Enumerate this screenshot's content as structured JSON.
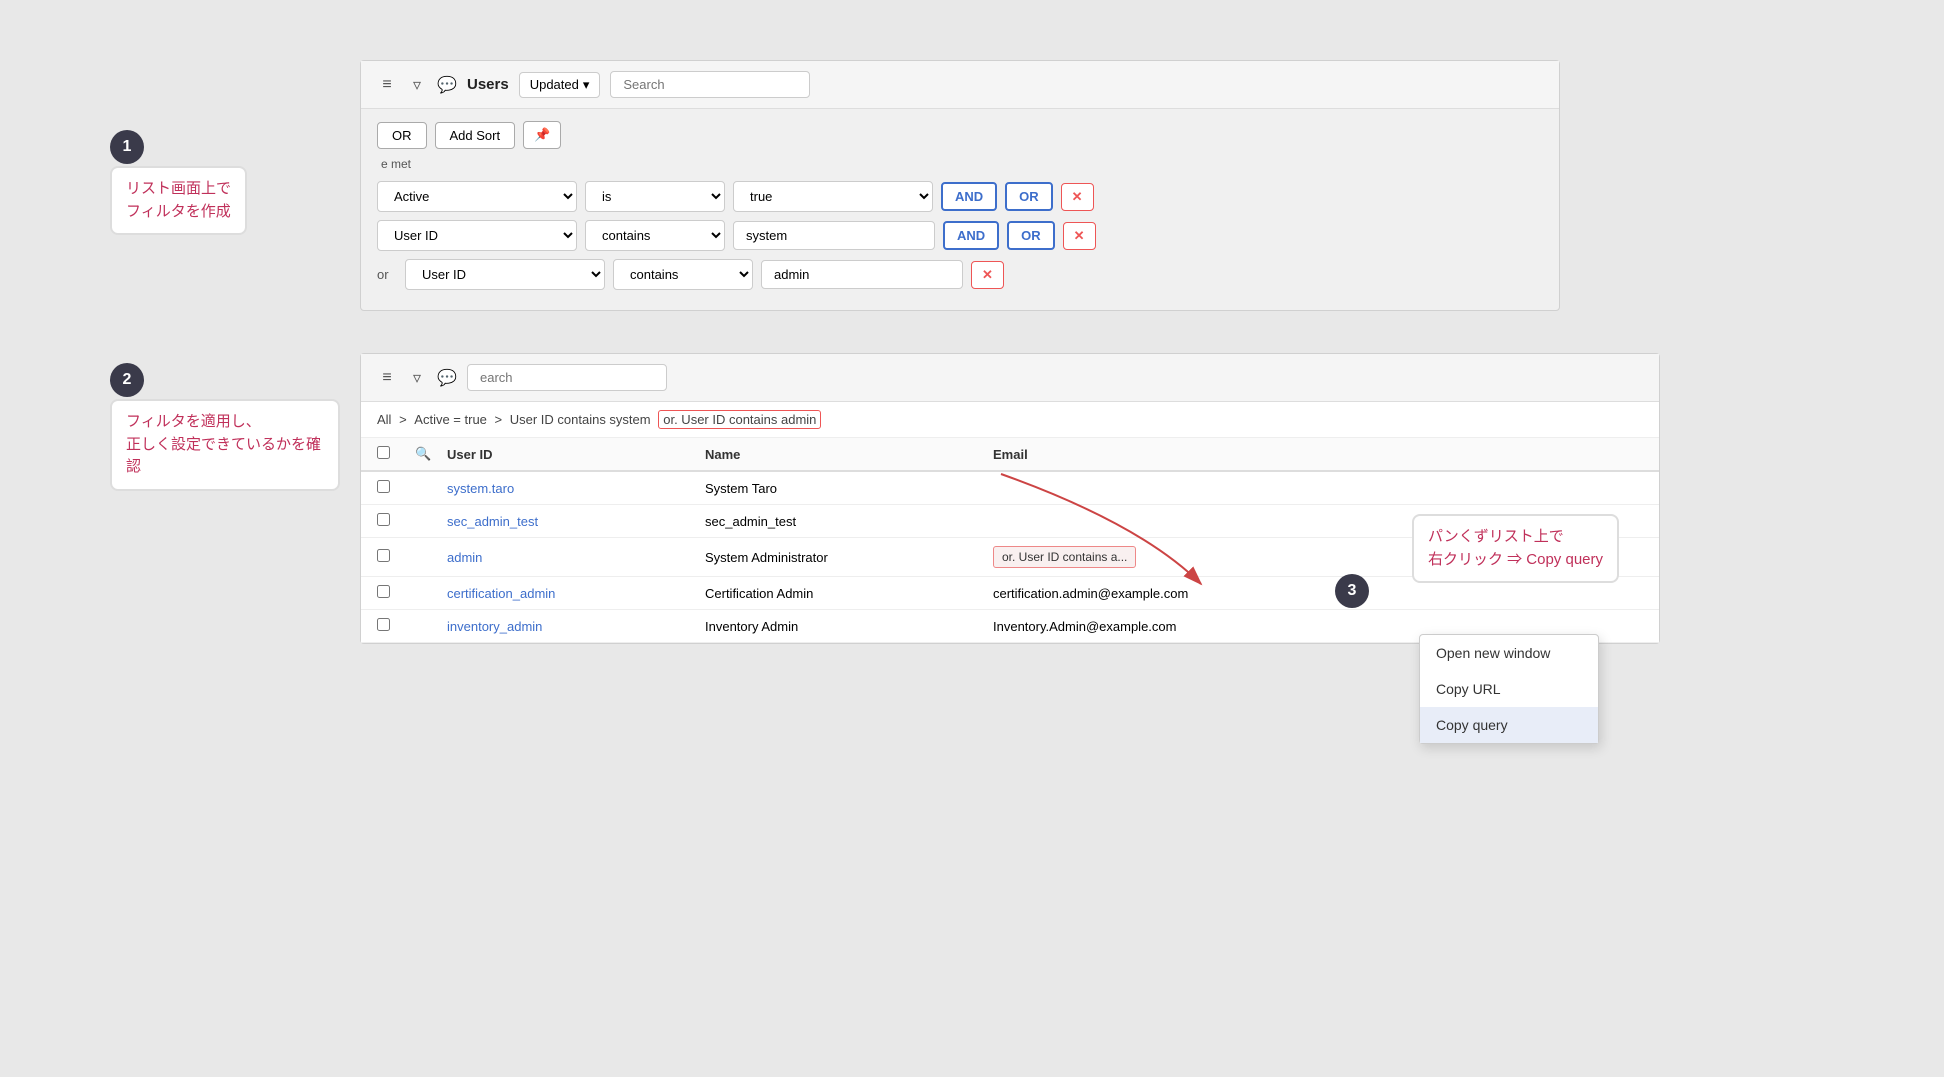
{
  "toolbar": {
    "menu_icon": "≡",
    "filter_icon": "⊽",
    "comment_icon": "💬",
    "title": "Users",
    "updated_label": "Updated",
    "search_placeholder": "Search",
    "dropdown_arrow": "▾"
  },
  "filter_toolbar": {
    "or_label": "OR",
    "add_sort_label": "Add Sort",
    "pin_icon": "📌"
  },
  "conditions": {
    "met_text": "e met"
  },
  "filter_rows": [
    {
      "label": "",
      "field": "Active",
      "operator": "is",
      "value": "true",
      "and_label": "AND",
      "or_label": "OR"
    },
    {
      "label": "",
      "field": "User ID",
      "operator": "contains",
      "value": "system",
      "and_label": "AND",
      "or_label": "OR"
    },
    {
      "label": "or",
      "field": "User ID",
      "operator": "contains",
      "value": "admin"
    }
  ],
  "annotation1": {
    "circle": "1",
    "text": "リスト画面上で\nフィルタを作成"
  },
  "annotation2": {
    "circle": "2",
    "text": "フィルタを適用し、\n正しく設定できているかを確認"
  },
  "annotation3": {
    "circle": "3",
    "text": "パンくずリスト上で\n右クリック ⇒ Copy query"
  },
  "section2": {
    "search_placeholder": "earch",
    "breadcrumb": {
      "all": "All",
      "part1": "Active = true",
      "part2": "User ID contains system",
      "highlighted": "or. User ID contains admin"
    }
  },
  "table": {
    "col_userid": "User ID",
    "col_name": "Name",
    "col_email": "Email",
    "rows": [
      {
        "userid": "system.taro",
        "name": "System Taro",
        "email": ""
      },
      {
        "userid": "sec_admin_test",
        "name": "sec_admin_test",
        "email": ""
      },
      {
        "userid": "admin",
        "name": "System Administrator",
        "email": ""
      },
      {
        "userid": "certification_admin",
        "name": "Certification Admin",
        "email": "certification.admin@example.com"
      },
      {
        "userid": "inventory_admin",
        "name": "Inventory Admin",
        "email": "Inventory.Admin@example.com"
      }
    ]
  },
  "context_menu": {
    "items": [
      {
        "label": "Open new window",
        "active": false
      },
      {
        "label": "Copy URL",
        "active": false
      },
      {
        "label": "Copy query",
        "active": true
      }
    ]
  },
  "tooltip_partial": {
    "text1": "or. User ID contains a...",
    "text2": "User ID contains a..."
  }
}
